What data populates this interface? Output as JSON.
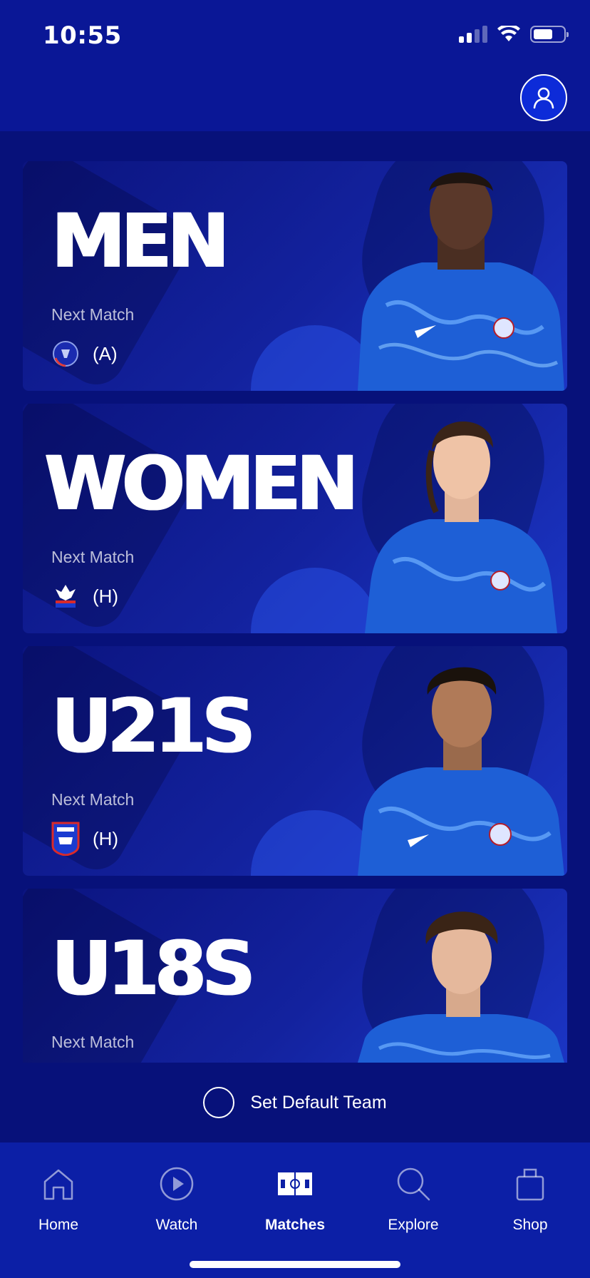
{
  "status_bar": {
    "time": "10:55"
  },
  "header": {
    "profile_icon": "user-icon"
  },
  "teams": [
    {
      "name": "MEN",
      "next_label": "Next Match",
      "venue": "(A)",
      "crest": "fc-copenhagen-crest"
    },
    {
      "name": "WOMEN",
      "next_label": "Next Match",
      "venue": "(H)",
      "crest": "crystal-palace-crest"
    },
    {
      "name": "U21S",
      "next_label": "Next Match",
      "venue": "(H)",
      "crest": "ipswich-town-crest"
    },
    {
      "name": "U18S",
      "next_label": "Next Match",
      "venue": "",
      "crest": ""
    }
  ],
  "default_team": {
    "label": "Set Default Team"
  },
  "tabs": [
    {
      "label": "Home",
      "icon": "home-icon"
    },
    {
      "label": "Watch",
      "icon": "play-icon"
    },
    {
      "label": "Matches",
      "icon": "pitch-icon",
      "active": true
    },
    {
      "label": "Explore",
      "icon": "search-icon"
    },
    {
      "label": "Shop",
      "icon": "bag-icon"
    }
  ],
  "colors": {
    "background": "#07117a",
    "tab_bar": "#0c1fa6",
    "accent": "#0d2bd8"
  }
}
